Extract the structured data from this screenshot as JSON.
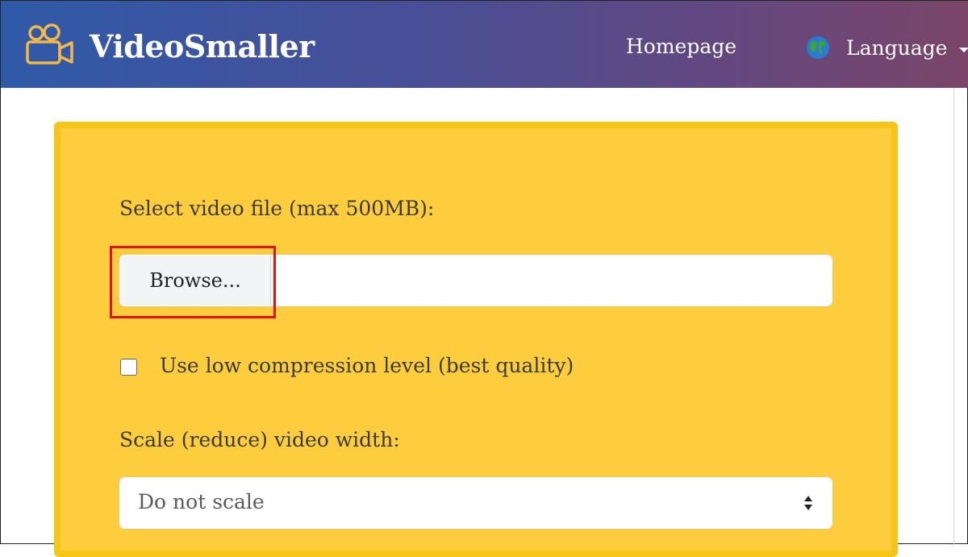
{
  "header": {
    "brand": "VideoSmaller",
    "logo_icon": "video-camera-icon",
    "nav": {
      "homepage": "Homepage",
      "language": "Language",
      "language_icon": "globe-icon"
    }
  },
  "form": {
    "file_label": "Select video file (max 500MB):",
    "browse_label": "Browse...",
    "low_compression_label": "Use low compression level (best quality)",
    "low_compression_checked": false,
    "scale_label": "Scale (reduce) video width:",
    "scale_selected": "Do not scale"
  },
  "colors": {
    "card_background": "#fdcd3e",
    "card_border": "#f5c518",
    "highlight": "#e0121b",
    "nav_gradient_start": "#2f5aa8",
    "nav_gradient_end": "#7a4568"
  }
}
